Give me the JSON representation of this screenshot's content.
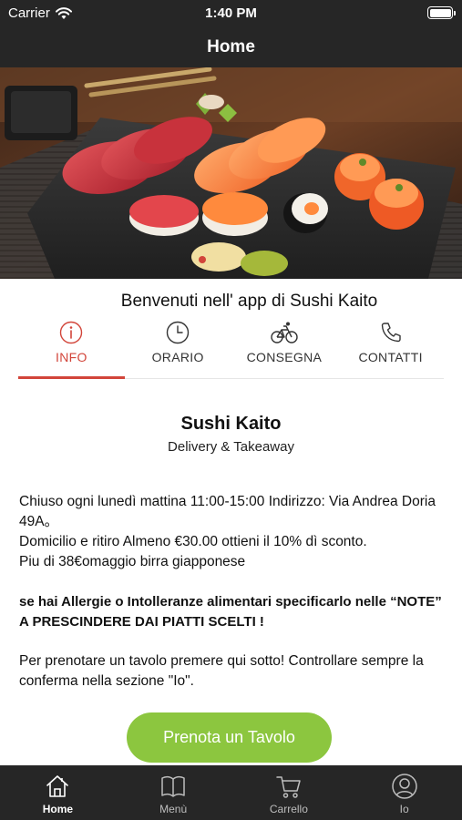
{
  "status_bar": {
    "carrier": "Carrier",
    "time": "1:40 PM",
    "icons": [
      "wifi-icon",
      "battery-icon"
    ]
  },
  "nav": {
    "title": "Home"
  },
  "hero": {
    "image": "sushi-platter-photo"
  },
  "welcome_text": "Benvenuti nell' app di Sushi Kaito",
  "tabs": [
    {
      "label": "INFO",
      "icon": "info-icon",
      "active": true
    },
    {
      "label": "ORARIO",
      "icon": "clock-icon",
      "active": false
    },
    {
      "label": "CONSEGNA",
      "icon": "bicycle-icon",
      "active": false
    },
    {
      "label": "CONTATTI",
      "icon": "phone-icon",
      "active": false
    }
  ],
  "restaurant": {
    "name": "Sushi Kaito",
    "subtitle": "Delivery & Takeaway"
  },
  "info": {
    "line1": "Chiuso ogni lunedì mattina 11:00-15:00 Indirizzo: Via Andrea Doria 49A。",
    "line2": "Domicilio e ritiro Almeno €30.00 ottieni il 10% dì sconto.",
    "line3": "Piu di 38€omaggio birra giapponese"
  },
  "allergy_note": "se hai Allergie o Intolleranze alimentari specificarlo nelle “NOTE” A PRESCINDERE DAI PIATTI SCELTI !",
  "booking_note": "Per prenotare un tavolo premere qui sotto! Controllare sempre la conferma nella sezione \"Io\".",
  "book_button_label": "Prenota un Tavolo",
  "tab_bar": [
    {
      "label": "Home",
      "icon": "home-icon",
      "active": true
    },
    {
      "label": "Menù",
      "icon": "book-icon",
      "active": false
    },
    {
      "label": "Carrello",
      "icon": "cart-icon",
      "active": false
    },
    {
      "label": "Io",
      "icon": "user-icon",
      "active": false
    }
  ],
  "colors": {
    "bar_background": "#262626",
    "accent_red": "#d2453a",
    "button_green": "#8cc63f"
  }
}
